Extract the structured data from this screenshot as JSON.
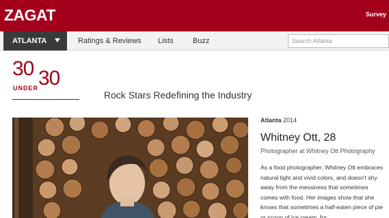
{
  "brand": {
    "logo_text": "ZAGAT",
    "survey_label": "Survey",
    "color": "#a3001b"
  },
  "nav": {
    "city": "ATLANTA",
    "links": [
      "Ratings & Reviews",
      "Lists",
      "Buzz"
    ],
    "search_placeholder": "Search Atlanta"
  },
  "badge": {
    "num_left": "30",
    "under": "UNDER",
    "num_right": "30"
  },
  "headline": "Rock Stars Redefining the Industry",
  "profile": {
    "city": "Atlanta",
    "year": "2014",
    "name": "Whitney Ott, 28",
    "role": "Photographer at Whitney Ott Photography",
    "bio": "As a food photographer, Whitney Ott embraces natural light and vivid colors, and doesn't shy away from the messiness that sometimes comes with food. Her images show that she knows that sometimes a half-eaten piece of pie or scoop of ice cream, for"
  },
  "photo": {
    "subject": "woman-in-front-of-firewood-stack"
  }
}
